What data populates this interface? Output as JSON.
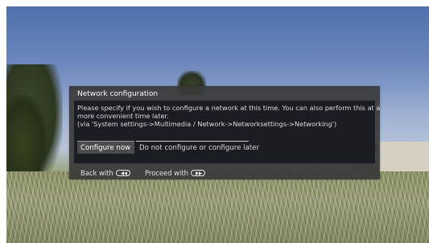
{
  "dialog": {
    "title": "Network configuration",
    "message_lines": [
      "Please specify if you wish to configure a network at this time. You can also perform this at a",
      "more convenient time later.",
      "(via 'System settings->Multimedia / Network->Networksettings->Networking')"
    ],
    "buttons": {
      "configure_now": "Configure now",
      "configure_later": "Do not configure or configure later"
    },
    "footer": {
      "back_label": "Back with",
      "back_key_icon": "rewind-key-icon",
      "proceed_label": "Proceed with",
      "proceed_key_icon": "fast-forward-key-icon"
    }
  },
  "colors": {
    "dialog_background": "#3a3a3a",
    "dialog_body_background": "#1b1d22",
    "selected_button": "#4a4b4f",
    "text": "#ffffff"
  }
}
